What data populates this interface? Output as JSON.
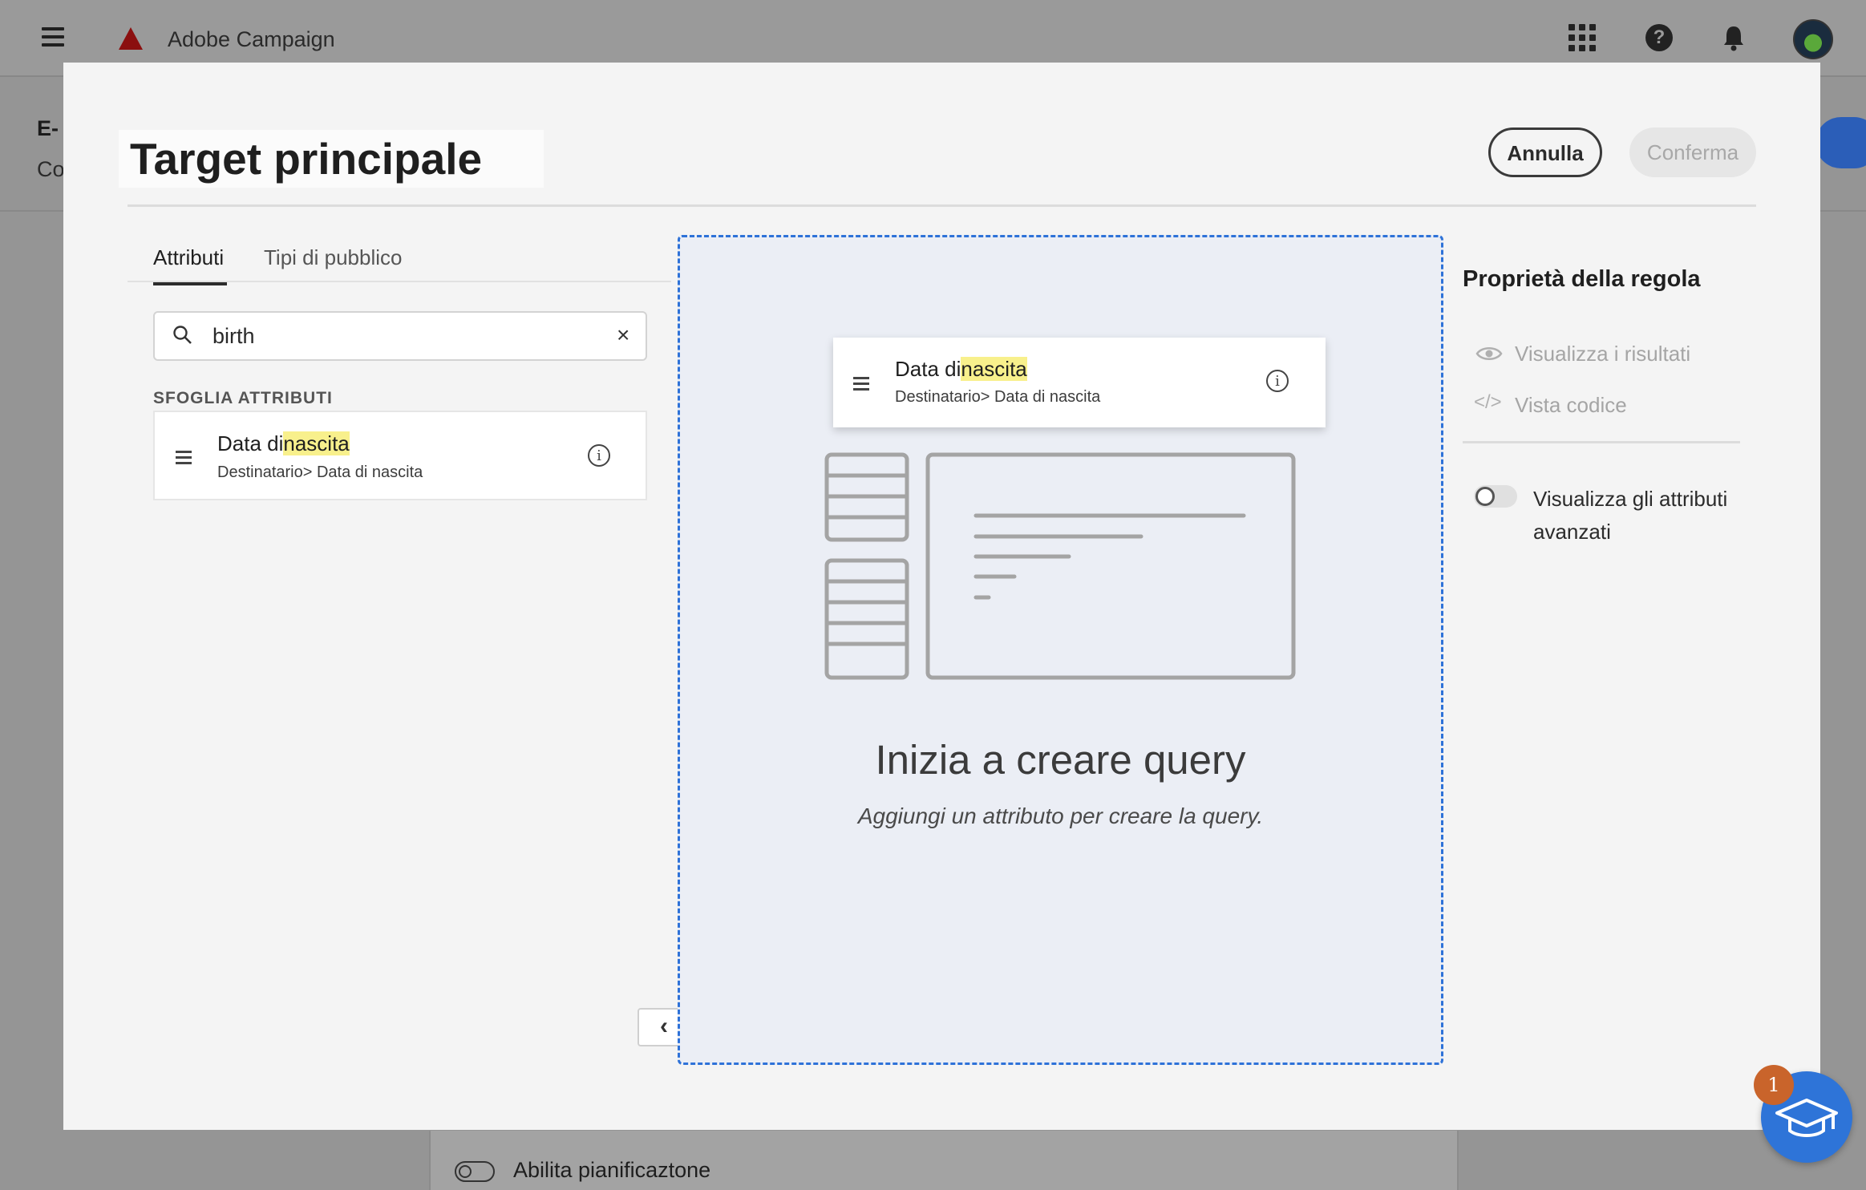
{
  "app": {
    "brand_name": "Adobe Campaign"
  },
  "topbar": {
    "icons": [
      "hamburger-menu-icon",
      "adobe-logo-icon",
      "apps-grid-icon",
      "help-icon",
      "bell-icon",
      "avatar"
    ],
    "help_glyph": "?"
  },
  "background_page": {
    "title_fragment": "E-",
    "subtitle_fragment": "Co",
    "toggle_label": "Abilita pianificaztone"
  },
  "modal": {
    "title": "Target principale",
    "cancel_label": "Annulla",
    "confirm_label": "Conferma",
    "tabs": [
      {
        "label": "Attributi",
        "active": true
      },
      {
        "label": "Tipi di pubblico",
        "active": false
      }
    ],
    "search": {
      "value": "birth",
      "clear_glyph": "×"
    },
    "browse_label": "SFOGLIA ATTRIBUTI",
    "attribute": {
      "name_prefix": "Data di",
      "name_highlight": "nascita",
      "path": "Destinatario> Data di nascita"
    },
    "dragged_attribute": {
      "name_prefix": "Data di",
      "name_highlight": "nascita",
      "path": "Destinatario> Data di nascita"
    },
    "canvas": {
      "empty_title": "Inizia a creare query",
      "empty_subtitle": "Aggiungi un attributo per creare la query."
    },
    "collapse_glyph": "‹",
    "rule_properties": {
      "title": "Proprietà della regola",
      "view_results_label": "Visualizza i risultati",
      "code_view_label": "Vista codice",
      "code_glyph": "</>",
      "advanced_toggle_label": "Visualizza gli attributi avanzati",
      "advanced_toggle_on": false
    }
  },
  "help_fab": {
    "badge_count": "1",
    "icon": "graduation-cap-icon"
  },
  "colors": {
    "accent": "#2e72d8",
    "highlight": "#f8f08c",
    "badge": "#c9642b"
  }
}
